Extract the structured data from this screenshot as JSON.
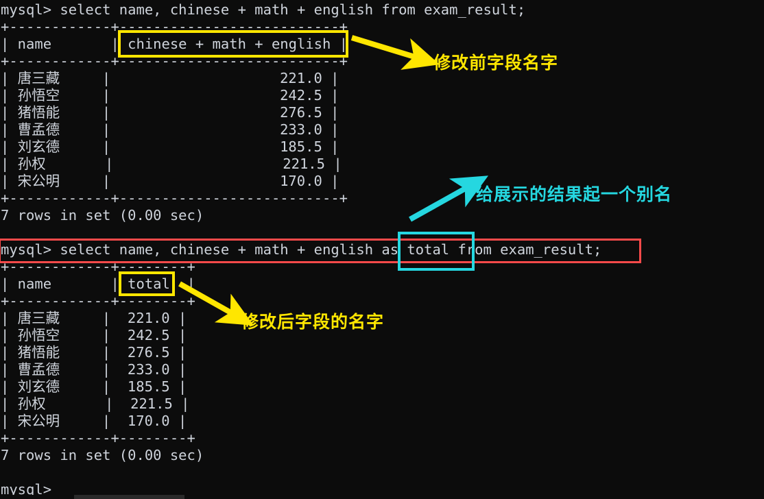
{
  "terminal": {
    "background_color": "#0c0c0c",
    "text_color": "#cfd4dc",
    "lines": [
      {
        "id": "l1",
        "type": "command",
        "text": "mysql> select name, chinese + math + english from exam_result;"
      },
      {
        "id": "l2",
        "type": "rule",
        "text": "+------------+--------------------------+"
      },
      {
        "id": "l3",
        "type": "header",
        "text": "| name       | chinese + math + english |"
      },
      {
        "id": "l4",
        "type": "rule",
        "text": "+------------+--------------------------+"
      },
      {
        "id": "l5",
        "type": "row",
        "text": "| 唐三藏     |                    221.0 |"
      },
      {
        "id": "l6",
        "type": "row",
        "text": "| 孙悟空     |                    242.5 |"
      },
      {
        "id": "l7",
        "type": "row",
        "text": "| 猪悟能     |                    276.5 |"
      },
      {
        "id": "l8",
        "type": "row",
        "text": "| 曹孟德     |                    233.0 |"
      },
      {
        "id": "l9",
        "type": "row",
        "text": "| 刘玄德     |                    185.5 |"
      },
      {
        "id": "l10",
        "type": "row",
        "text": "| 孙权       |                    221.5 |"
      },
      {
        "id": "l11",
        "type": "row",
        "text": "| 宋公明     |                    170.0 |"
      },
      {
        "id": "l12",
        "type": "rule",
        "text": "+------------+--------------------------+"
      },
      {
        "id": "l13",
        "type": "status",
        "text": "7 rows in set (0.00 sec)"
      },
      {
        "id": "l14",
        "type": "blank",
        "text": ""
      },
      {
        "id": "l15",
        "type": "command",
        "text": "mysql> select name, chinese + math + english as total from exam_result;"
      },
      {
        "id": "l16",
        "type": "rule",
        "text": "+------------+--------+"
      },
      {
        "id": "l17",
        "type": "header",
        "text": "| name       | total  |"
      },
      {
        "id": "l18",
        "type": "rule",
        "text": "+------------+--------+"
      },
      {
        "id": "l19",
        "type": "row",
        "text": "| 唐三藏     |  221.0 |"
      },
      {
        "id": "l20",
        "type": "row",
        "text": "| 孙悟空     |  242.5 |"
      },
      {
        "id": "l21",
        "type": "row",
        "text": "| 猪悟能     |  276.5 |"
      },
      {
        "id": "l22",
        "type": "row",
        "text": "| 曹孟德     |  233.0 |"
      },
      {
        "id": "l23",
        "type": "row",
        "text": "| 刘玄德     |  185.5 |"
      },
      {
        "id": "l24",
        "type": "row",
        "text": "| 孙权       |  221.5 |"
      },
      {
        "id": "l25",
        "type": "row",
        "text": "| 宋公明     |  170.0 |"
      },
      {
        "id": "l26",
        "type": "rule",
        "text": "+------------+--------+"
      },
      {
        "id": "l27",
        "type": "status",
        "text": "7 rows in set (0.00 sec)"
      },
      {
        "id": "l28",
        "type": "blank",
        "text": ""
      },
      {
        "id": "l29",
        "type": "prompt",
        "text": "mysql>"
      }
    ],
    "queries": {
      "first": "select name, chinese + math + english from exam_result;",
      "second": "select name, chinese + math + english as total from exam_result;",
      "prompt_symbol": "mysql>"
    },
    "result_table_1": {
      "columns": [
        "name",
        "chinese + math + english"
      ],
      "rows": [
        [
          "唐三藏",
          "221.0"
        ],
        [
          "孙悟空",
          "242.5"
        ],
        [
          "猪悟能",
          "276.5"
        ],
        [
          "曹孟德",
          "233.0"
        ],
        [
          "刘玄德",
          "185.5"
        ],
        [
          "孙权",
          "221.5"
        ],
        [
          "宋公明",
          "170.0"
        ]
      ],
      "footer": "7 rows in set (0.00 sec)"
    },
    "result_table_2": {
      "columns": [
        "name",
        "total"
      ],
      "rows": [
        [
          "唐三藏",
          "221.0"
        ],
        [
          "孙悟空",
          "242.5"
        ],
        [
          "猪悟能",
          "276.5"
        ],
        [
          "曹孟德",
          "233.0"
        ],
        [
          "刘玄德",
          "185.5"
        ],
        [
          "孙权",
          "221.5"
        ],
        [
          "宋公明",
          "170.0"
        ]
      ],
      "footer": "7 rows in set (0.00 sec)"
    }
  },
  "annotations": {
    "colors": {
      "yellow": "#ffe600",
      "cyan": "#25d7e0",
      "red": "#fb4a4a"
    },
    "highlight_boxes": [
      {
        "id": "box-old-field",
        "color": "#ffe600",
        "target": "chinese + math + english"
      },
      {
        "id": "box-new-field",
        "color": "#ffe600",
        "target": "total"
      },
      {
        "id": "box-alias",
        "color": "#25d7e0",
        "target": "as total"
      },
      {
        "id": "box-query-line",
        "color": "#fb4a4a",
        "target": "mysql> select name, chinese + math + english as total from exam_result;"
      }
    ],
    "labels": [
      {
        "id": "label-before",
        "text": "修改前字段名字",
        "color": "#ffe600"
      },
      {
        "id": "label-alias",
        "text": "给展示的结果起一个别名",
        "color": "#25d7e0"
      },
      {
        "id": "label-after",
        "text": "修改后字段的名字",
        "color": "#ffe600"
      }
    ]
  }
}
